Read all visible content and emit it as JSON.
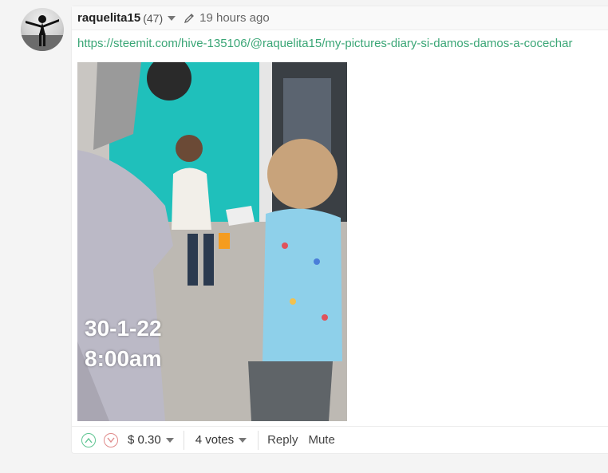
{
  "comment": {
    "author": "raquelita15",
    "reputation": "(47)",
    "timestamp": "19 hours ago",
    "link": "https://steemit.com/hive-135106/@raquelita15/my-pictures-diary-si-damos-damos-a-cocechar",
    "photo": {
      "date_text": "30-1-22",
      "time_text": "8:00am"
    }
  },
  "footer": {
    "payout": "$ 0.30",
    "votes": "4 votes",
    "reply_label": "Reply",
    "mute_label": "Mute"
  },
  "colors": {
    "link": "#3aa676",
    "upvote": "#5fc592",
    "downvote": "#e08b8b",
    "wall": "#1fc0bb"
  },
  "icons": [
    "avatar",
    "chevron-down-icon",
    "pencil-icon",
    "upvote-icon",
    "downvote-icon"
  ]
}
